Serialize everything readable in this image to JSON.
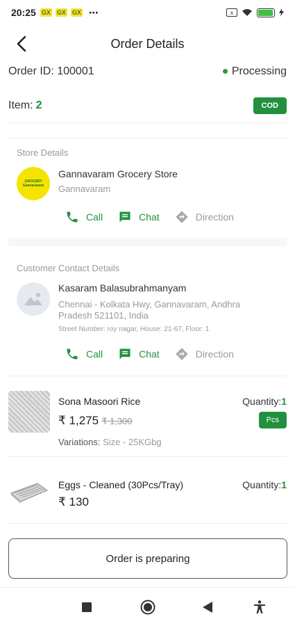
{
  "status_bar": {
    "time": "20:25",
    "notification_badges": [
      "GX",
      "GX",
      "GX"
    ],
    "more": "⋯",
    "sim": "x",
    "battery_level": 0.95
  },
  "app_bar": {
    "title": "Order Details"
  },
  "order": {
    "id_label": "Order ID: 100001",
    "status": "Processing",
    "item_label": "Item:",
    "item_count": "2",
    "payment_badge": "COD"
  },
  "store": {
    "section_title": "Store Details",
    "logo_text": [
      "GROCERY",
      "Gannavaram"
    ],
    "name": "Gannavaram Grocery Store",
    "location": "Gannavaram",
    "actions": {
      "call": "Call",
      "chat": "Chat",
      "direction": "Direction"
    }
  },
  "customer": {
    "section_title": "Customer Contact Details",
    "name": "Kasaram Balasubrahmanyam",
    "address_line1": "Chennai - Kolkata Hwy, Gannavaram, Andhra",
    "address_line2": "Pradesh 521101, India",
    "street": "Street Number: roy nagar, House: 21-67, Floor: 1",
    "actions": {
      "call": "Call",
      "chat": "Chat",
      "direction": "Direction"
    }
  },
  "products": [
    {
      "name": "Sona Masoori Rice",
      "quantity_label": "Quantity:",
      "quantity": "1",
      "price": "₹ 1,275",
      "old_price": "₹ 1,300",
      "unit": "Pcs",
      "variations_label": "Variations:",
      "variations_value": "Size - 25KGbg"
    },
    {
      "name": "Eggs - Cleaned (30Pcs/Tray)",
      "quantity_label": "Quantity:",
      "quantity": "1",
      "price": "₹ 130"
    }
  ],
  "primary_action": {
    "label": "Order is preparing"
  },
  "colors": {
    "accent_green": "#22913f",
    "muted_text": "#9a9a9a"
  }
}
